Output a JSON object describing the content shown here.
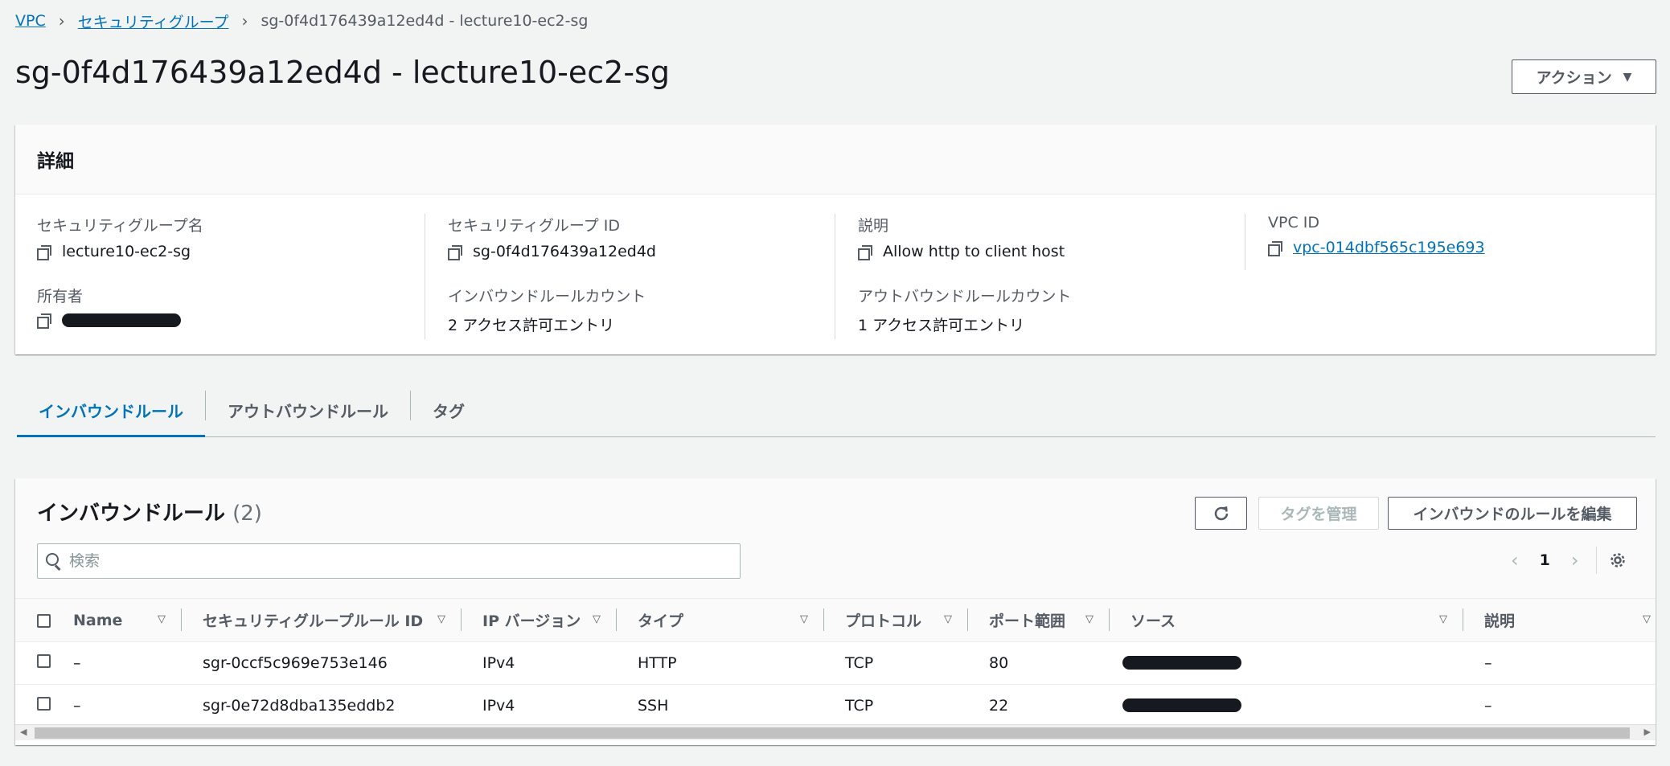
{
  "breadcrumb": {
    "vpc": "VPC",
    "security_groups": "セキュリティグループ",
    "current": "sg-0f4d176439a12ed4d - lecture10-ec2-sg"
  },
  "page": {
    "title": "sg-0f4d176439a12ed4d - lecture10-ec2-sg",
    "actions_label": "アクション"
  },
  "details": {
    "header": "詳細",
    "fields": {
      "sg_name": {
        "label": "セキュリティグループ名",
        "value": "lecture10-ec2-sg"
      },
      "sg_id": {
        "label": "セキュリティグループ ID",
        "value": "sg-0f4d176439a12ed4d"
      },
      "description": {
        "label": "説明",
        "value": "Allow http to client host"
      },
      "vpc_id": {
        "label": "VPC ID",
        "value": "vpc-014dbf565c195e693"
      },
      "owner": {
        "label": "所有者",
        "value": ""
      },
      "inbound_count": {
        "label": "インバウンドルールカウント",
        "value": "2 アクセス許可エントリ"
      },
      "outbound_count": {
        "label": "アウトバウンドルールカウント",
        "value": "1 アクセス許可エントリ"
      }
    }
  },
  "tabs": [
    {
      "label": "インバウンドルール",
      "active": true
    },
    {
      "label": "アウトバウンドルール",
      "active": false
    },
    {
      "label": "タグ",
      "active": false
    }
  ],
  "inbound": {
    "title": "インバウンドルール",
    "count": "(2)",
    "manage_tags_label": "タグを管理",
    "edit_rules_label": "インバウンドのルールを編集",
    "search_placeholder": "検索",
    "page_number": "1",
    "columns": [
      "Name",
      "セキュリティグループルール ID",
      "IP バージョン",
      "タイプ",
      "プロトコル",
      "ポート範囲",
      "ソース",
      "説明"
    ],
    "rows": [
      {
        "name": "–",
        "rule_id": "sgr-0ccf5c969e753e146",
        "ip_version": "IPv4",
        "type": "HTTP",
        "protocol": "TCP",
        "port_range": "80",
        "source": "",
        "description": "–"
      },
      {
        "name": "–",
        "rule_id": "sgr-0e72d8dba135eddb2",
        "ip_version": "IPv4",
        "type": "SSH",
        "protocol": "TCP",
        "port_range": "22",
        "source": "",
        "description": "–"
      }
    ]
  },
  "colors": {
    "link": "#0073bb",
    "background": "#f2f3f3",
    "text": "#16191f",
    "secondary_text": "#545b64"
  }
}
